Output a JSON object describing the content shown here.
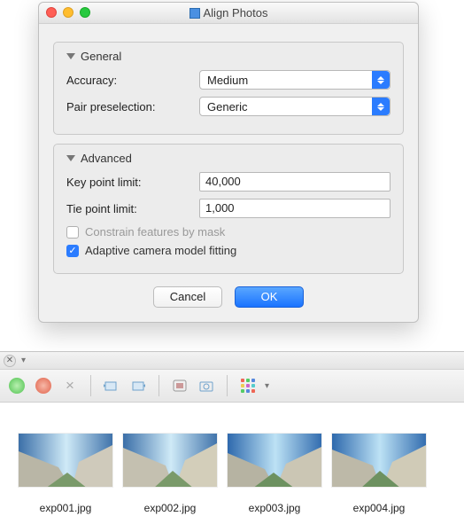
{
  "dialog": {
    "title": "Align Photos",
    "general": {
      "header": "General",
      "accuracy_label": "Accuracy:",
      "accuracy_value": "Medium",
      "pair_label": "Pair preselection:",
      "pair_value": "Generic"
    },
    "advanced": {
      "header": "Advanced",
      "key_point_label": "Key point limit:",
      "key_point_value": "40,000",
      "tie_point_label": "Tie point limit:",
      "tie_point_value": "1,000",
      "constrain_label": "Constrain features by mask",
      "constrain_checked": false,
      "adaptive_label": "Adaptive camera model fitting",
      "adaptive_checked": true
    },
    "cancel": "Cancel",
    "ok": "OK"
  },
  "toolbar": {
    "approve": "approve-icon",
    "remove": "remove-icon",
    "delete": "delete-icon",
    "rotate_left": "rotate-left-icon",
    "rotate_right": "rotate-right-icon",
    "mask": "mask-icon",
    "camera": "camera-icon",
    "view_grid": "thumbnail-grid-icon"
  },
  "files": [
    {
      "name": "exp001.jpg"
    },
    {
      "name": "exp002.jpg"
    },
    {
      "name": "exp003.jpg"
    },
    {
      "name": "exp004.jpg"
    }
  ]
}
